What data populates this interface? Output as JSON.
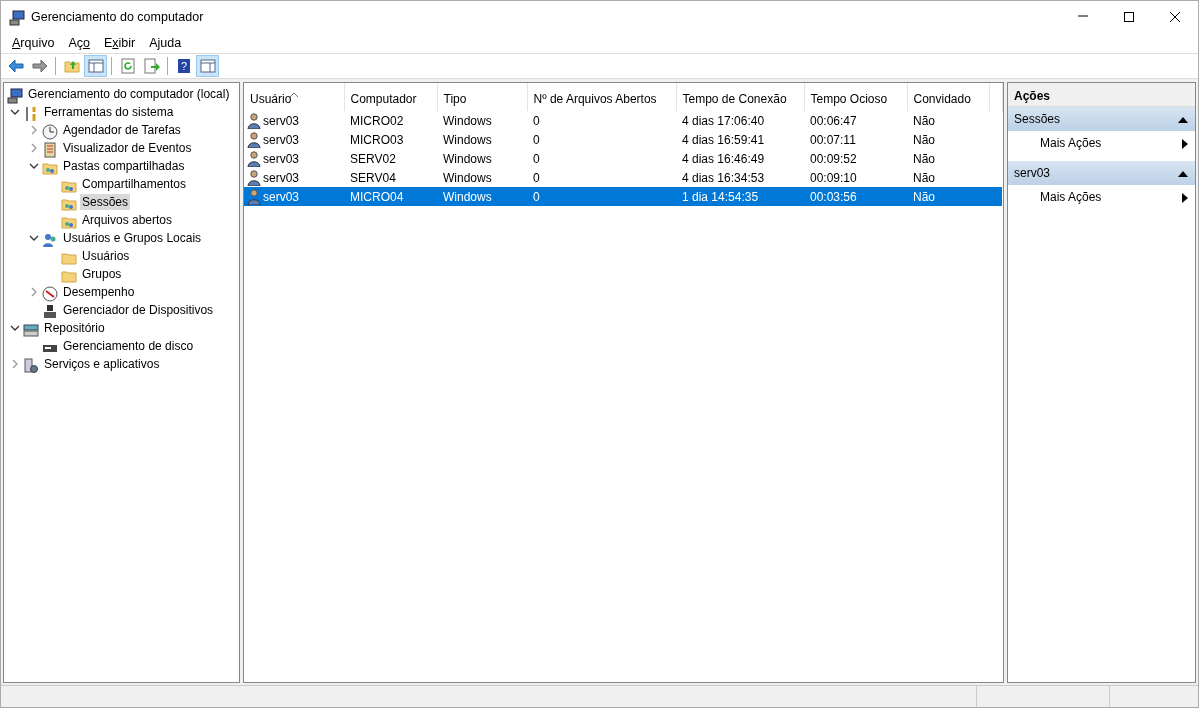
{
  "window": {
    "title": "Gerenciamento do computador"
  },
  "menu": [
    {
      "key": "A",
      "post": "rquivo"
    },
    {
      "pre": "Aç",
      "key": "o"
    },
    {
      "pre": "E",
      "key": "x",
      "post": "ibir"
    },
    {
      "pre": "A",
      "key": "j",
      "post": "uda"
    }
  ],
  "toolbar": [
    {
      "kind": "back",
      "pressed": false
    },
    {
      "kind": "forward",
      "pressed": false
    },
    {
      "kind": "separator"
    },
    {
      "kind": "up",
      "pressed": false
    },
    {
      "kind": "tree-pane",
      "pressed": true
    },
    {
      "kind": "separator"
    },
    {
      "kind": "refresh",
      "pressed": false
    },
    {
      "kind": "export",
      "pressed": false
    },
    {
      "kind": "separator"
    },
    {
      "kind": "help",
      "glyph": "?",
      "pressed": false
    },
    {
      "kind": "action-pane",
      "pressed": true
    }
  ],
  "tree": [
    {
      "label": "Gerenciamento do computador (local)",
      "kind": "computer",
      "selected": false,
      "children": [
        {
          "label": "Ferramentas do sistema",
          "kind": "tools",
          "expanded": true,
          "selected": false,
          "children": [
            {
              "label": "Agendador de Tarefas",
              "kind": "clock",
              "expanded": false,
              "selected": false
            },
            {
              "label": "Visualizador de Eventos",
              "kind": "events",
              "expanded": false,
              "selected": false
            },
            {
              "label": "Pastas compartilhadas",
              "kind": "share",
              "expanded": true,
              "selected": false,
              "children": [
                {
                  "label": "Compartilhamentos",
                  "kind": "share",
                  "selected": false
                },
                {
                  "label": "Sessões",
                  "kind": "share",
                  "selected": true
                },
                {
                  "label": "Arquivos abertos",
                  "kind": "share",
                  "selected": false
                }
              ]
            },
            {
              "label": "Usuários e Grupos Locais",
              "kind": "users",
              "expanded": true,
              "selected": false,
              "children": [
                {
                  "label": "Usuários",
                  "kind": "folder",
                  "selected": false
                },
                {
                  "label": "Grupos",
                  "kind": "folder",
                  "selected": false
                }
              ]
            },
            {
              "label": "Desempenho",
              "kind": "performance",
              "expanded": false,
              "selected": false
            },
            {
              "label": "Gerenciador de Dispositivos",
              "kind": "device",
              "selected": false
            }
          ]
        },
        {
          "label": "Repositório",
          "kind": "storage",
          "expanded": true,
          "selected": false,
          "children": [
            {
              "label": "Gerenciamento de disco",
              "kind": "disk",
              "selected": false
            }
          ]
        },
        {
          "label": "Serviços e aplicativos",
          "kind": "services",
          "expanded": false,
          "selected": false
        }
      ]
    }
  ],
  "table": {
    "columns": [
      {
        "label": "Usuário",
        "sorted": true
      },
      {
        "label": "Computador",
        "sorted": false
      },
      {
        "label": "Tipo",
        "sorted": false
      },
      {
        "label": "Nº de Arquivos Abertos",
        "sorted": false
      },
      {
        "label": "Tempo de Conexão",
        "sorted": false
      },
      {
        "label": "Tempo Ocioso",
        "sorted": false
      },
      {
        "label": "Convidado",
        "sorted": false
      }
    ],
    "rows": [
      {
        "selected": false,
        "cells": [
          "serv03",
          "MICRO02",
          "Windows",
          "0",
          "4 dias 17:06:40",
          "00:06:47",
          "Não"
        ]
      },
      {
        "selected": false,
        "cells": [
          "serv03",
          "MICRO03",
          "Windows",
          "0",
          "4 dias 16:59:41",
          "00:07:11",
          "Não"
        ]
      },
      {
        "selected": false,
        "cells": [
          "serv03",
          "SERV02",
          "Windows",
          "0",
          "4 dias 16:46:49",
          "00:09:52",
          "Não"
        ]
      },
      {
        "selected": false,
        "cells": [
          "serv03",
          "SERV04",
          "Windows",
          "0",
          "4 dias 16:34:53",
          "00:09:10",
          "Não"
        ]
      },
      {
        "selected": true,
        "cells": [
          "serv03",
          "MICRO04",
          "Windows",
          "0",
          "1 dia 14:54:35",
          "00:03:56",
          "Não"
        ]
      }
    ]
  },
  "actions": {
    "title": "Ações",
    "sections": [
      {
        "title": "Sessões",
        "expanded": true,
        "items": [
          {
            "label": "Mais Ações",
            "submenu": true
          }
        ]
      },
      {
        "title": "serv03",
        "expanded": true,
        "items": [
          {
            "label": "Mais Ações",
            "submenu": true
          }
        ]
      }
    ]
  }
}
